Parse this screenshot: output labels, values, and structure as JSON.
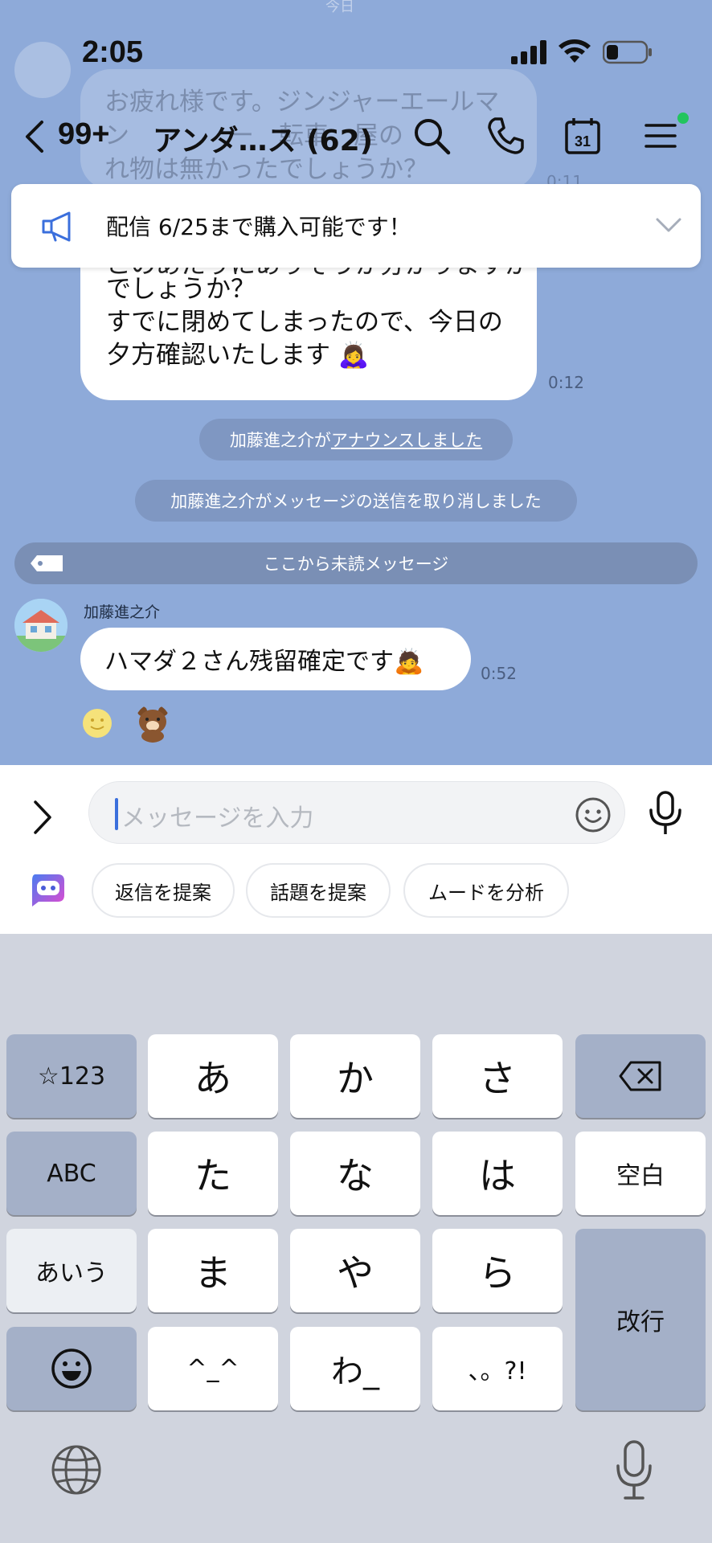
{
  "status": {
    "time": "2:05"
  },
  "header": {
    "back_count": "99+",
    "title": "アンダ…ス (62)"
  },
  "background": {
    "ghost_text": "お疲れ様です。ジンジャーエールマ\nン　　　　ー　転車　屋の\nれ物は無かったでしょうか？",
    "ghost_time": "0:11"
  },
  "announcement": {
    "text": "配信 6/25まで購入可能です！"
  },
  "messages": [
    {
      "partial_line": "このあたりにありそうか分かりますか",
      "text": "でしょうか？\nすでに閉めてしまったので、今日の\n夕方確認いたします 🙇‍♀️",
      "time": "0:12"
    }
  ],
  "system": {
    "announce_prefix": "加藤進之介が",
    "announce_link": "アナウンスしました",
    "unsend": "加藤進之介がメッセージの送信を取り消しました",
    "unread": "ここから未読メッセージ"
  },
  "message2": {
    "sender": "加藤進之介",
    "text": "ハマダ２さん残留確定です🙇",
    "time": "0:52"
  },
  "input": {
    "placeholder": "メッセージを入力"
  },
  "chips": [
    "返信を提案",
    "話題を提案",
    "ムードを分析"
  ],
  "keyboard": {
    "row1": [
      "☆123",
      "あ",
      "か",
      "さ"
    ],
    "row2": [
      "ABC",
      "た",
      "な",
      "は",
      "空白"
    ],
    "row3": [
      "あいう",
      "ま",
      "や",
      "ら"
    ],
    "row4": [
      "^_^",
      "わ_",
      "、。?!"
    ],
    "enter": "改行"
  },
  "colors": {
    "chat_bg": "#8eaad9",
    "accent": "#3b6fdc",
    "online": "#22c55e"
  }
}
